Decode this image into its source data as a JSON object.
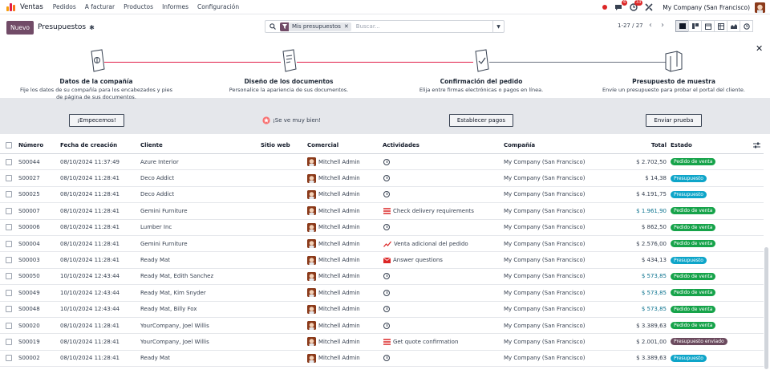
{
  "navbar": {
    "app_name": "Ventas",
    "menus": [
      "Pedidos",
      "A facturar",
      "Productos",
      "Informes",
      "Configuración"
    ],
    "chat_badge": "6",
    "activity_badge": "33",
    "company": "My Company (San Francisco)"
  },
  "control": {
    "new_label": "Nuevo",
    "title": "Presupuestos",
    "facet": "Mis presupuestos",
    "search_placeholder": "Buscar...",
    "pager": "1-27 / 27"
  },
  "onboarding": {
    "steps": [
      {
        "title": "Datos de la compañía",
        "desc": "Fije los datos de su compañía para los encabezados y pies de página de sus documentos.",
        "button": "¡Empecemos!"
      },
      {
        "title": "Diseño de los documentos",
        "desc": "Personalice la apariencia de sus documentos.",
        "done": "¡Se ve muy bien!"
      },
      {
        "title": "Confirmación del pedido",
        "desc": "Elija entre firmas electrónicas o pagos en línea.",
        "button": "Establecer pagos"
      },
      {
        "title": "Presupuesto de muestra",
        "desc": "Envíe un presupuesto para probar el portal del cliente.",
        "button": "Enviar prueba"
      }
    ]
  },
  "table": {
    "columns": [
      "Número",
      "Fecha de creación",
      "Cliente",
      "Sitio web",
      "Comercial",
      "Actividades",
      "Compañía",
      "Total",
      "Estado"
    ],
    "rows": [
      {
        "num": "S00044",
        "date": "08/10/2024 11:37:49",
        "client": "Azure Interior",
        "sales": "Mitchell Admin",
        "act": "",
        "act_icon": "clock",
        "company": "My Company (San Francisco)",
        "total": "$ 2.702,50",
        "total_color": "#374151",
        "status": "Pedido de venta"
      },
      {
        "num": "S00027",
        "date": "08/10/2024 11:28:41",
        "client": "Deco Addict",
        "sales": "Mitchell Admin",
        "act": "",
        "act_icon": "clock",
        "company": "My Company (San Francisco)",
        "total": "$ 14,38",
        "total_color": "#374151",
        "status": "Presupuesto"
      },
      {
        "num": "S00025",
        "date": "08/10/2024 11:28:41",
        "client": "Deco Addict",
        "sales": "Mitchell Admin",
        "act": "",
        "act_icon": "clock",
        "company": "My Company (San Francisco)",
        "total": "$ 4.191,75",
        "total_color": "#374151",
        "status": "Presupuesto"
      },
      {
        "num": "S00007",
        "date": "08/10/2024 11:28:41",
        "client": "Gemini Furniture",
        "sales": "Mitchell Admin",
        "act": "Check delivery requirements",
        "act_icon": "list",
        "company": "My Company (San Francisco)",
        "total": "$ 1.961,90",
        "total_color": "#0e7490",
        "status": "Pedido de venta"
      },
      {
        "num": "S00006",
        "date": "08/10/2024 11:28:41",
        "client": "Lumber Inc",
        "sales": "Mitchell Admin",
        "act": "",
        "act_icon": "clock",
        "company": "My Company (San Francisco)",
        "total": "$ 862,50",
        "total_color": "#374151",
        "status": "Pedido de venta"
      },
      {
        "num": "S00004",
        "date": "08/10/2024 11:28:41",
        "client": "Gemini Furniture",
        "sales": "Mitchell Admin",
        "act": "Venta adicional del pedido",
        "act_icon": "chart",
        "company": "My Company (San Francisco)",
        "total": "$ 2.576,00",
        "total_color": "#374151",
        "status": "Pedido de venta"
      },
      {
        "num": "S00003",
        "date": "08/10/2024 11:28:41",
        "client": "Ready Mat",
        "sales": "Mitchell Admin",
        "act": "Answer questions",
        "act_icon": "mail",
        "company": "My Company (San Francisco)",
        "total": "$ 434,13",
        "total_color": "#374151",
        "status": "Presupuesto"
      },
      {
        "num": "S00050",
        "date": "10/10/2024 12:43:44",
        "client": "Ready Mat, Edith Sanchez",
        "sales": "Mitchell Admin",
        "act": "",
        "act_icon": "clock",
        "company": "My Company (San Francisco)",
        "total": "$ 573,85",
        "total_color": "#0e7490",
        "status": "Pedido de venta"
      },
      {
        "num": "S00049",
        "date": "10/10/2024 12:43:44",
        "client": "Ready Mat, Kim Snyder",
        "sales": "Mitchell Admin",
        "act": "",
        "act_icon": "clock",
        "company": "My Company (San Francisco)",
        "total": "$ 573,85",
        "total_color": "#0e7490",
        "status": "Pedido de venta"
      },
      {
        "num": "S00048",
        "date": "10/10/2024 12:43:44",
        "client": "Ready Mat, Billy Fox",
        "sales": "Mitchell Admin",
        "act": "",
        "act_icon": "clock",
        "company": "My Company (San Francisco)",
        "total": "$ 573,85",
        "total_color": "#0e7490",
        "status": "Pedido de venta"
      },
      {
        "num": "S00020",
        "date": "08/10/2024 11:28:41",
        "client": "YourCompany, Joel Willis",
        "sales": "Mitchell Admin",
        "act": "",
        "act_icon": "clock",
        "company": "My Company (San Francisco)",
        "total": "$ 3.389,63",
        "total_color": "#374151",
        "status": "Pedido de venta"
      },
      {
        "num": "S00019",
        "date": "08/10/2024 11:28:41",
        "client": "YourCompany, Joel Willis",
        "sales": "Mitchell Admin",
        "act": "Get quote confirmation",
        "act_icon": "list",
        "company": "My Company (San Francisco)",
        "total": "$ 2.001,00",
        "total_color": "#374151",
        "status": "Presupuesto enviado"
      },
      {
        "num": "S00002",
        "date": "08/10/2024 11:28:41",
        "client": "Ready Mat",
        "sales": "Mitchell Admin",
        "act": "",
        "act_icon": "clock",
        "company": "My Company (San Francisco)",
        "total": "$ 3.389,63",
        "total_color": "#374151",
        "status": "Presupuesto"
      }
    ]
  },
  "colors": {
    "brand": "#714b67",
    "pedido": "#16a34a",
    "presupuesto": "#0ea5c9",
    "enviado": "#6b4a5e"
  }
}
